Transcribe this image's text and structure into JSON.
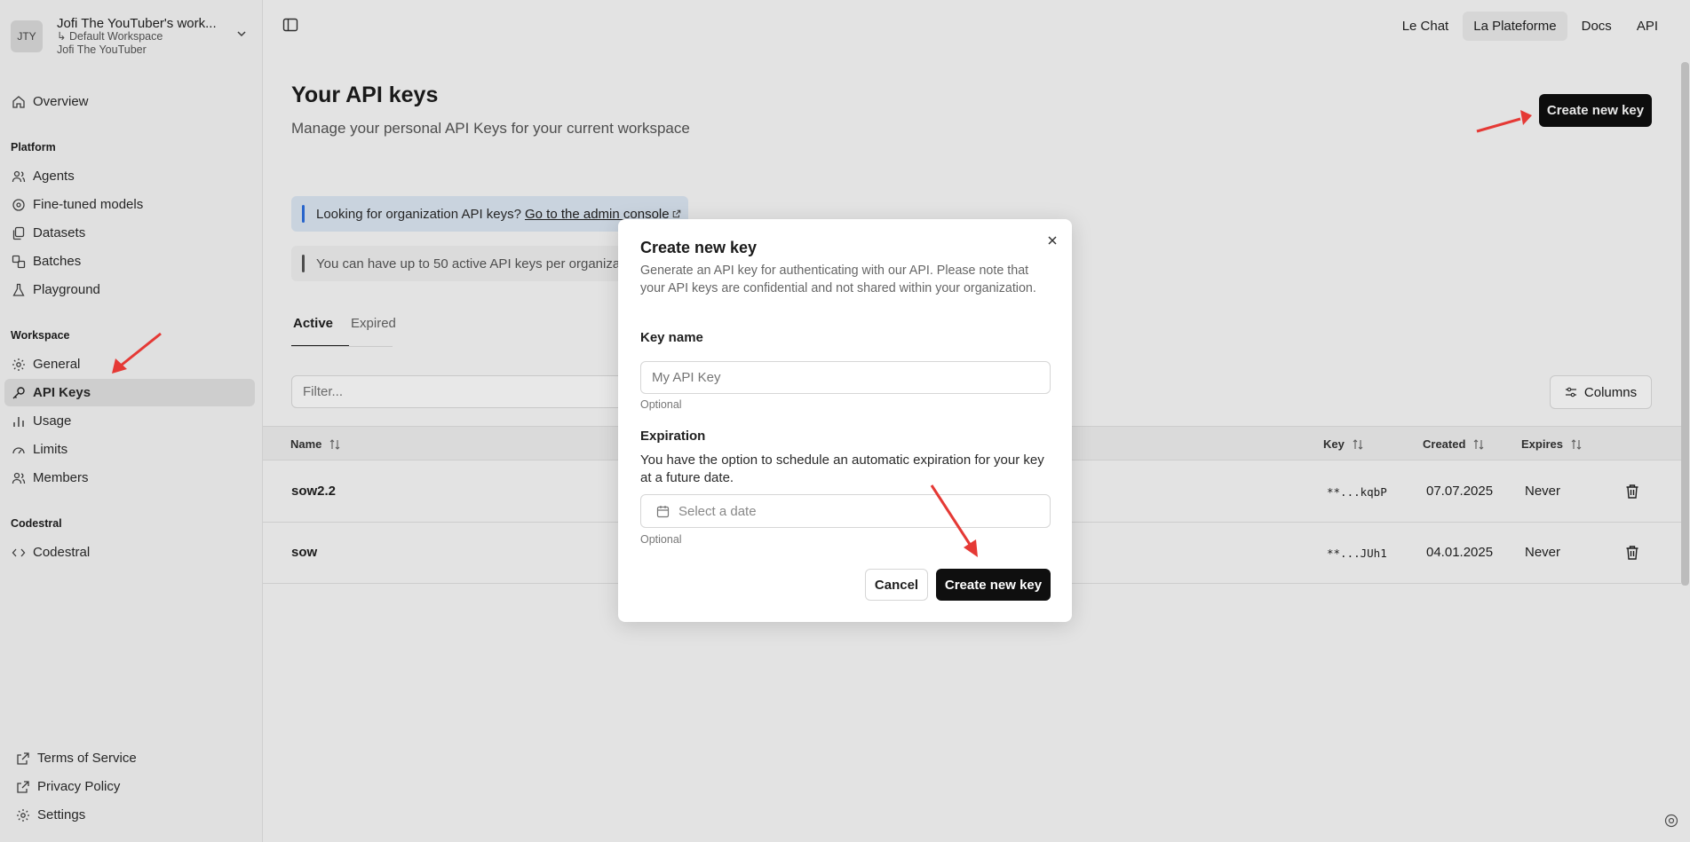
{
  "workspace": {
    "avatar": "JTY",
    "name": "Jofi The YouTuber's work...",
    "sub": "↳ Default Workspace",
    "owner": "Jofi The YouTuber"
  },
  "sidebar": {
    "overview": "Overview",
    "platform_title": "Platform",
    "platform": [
      "Agents",
      "Fine-tuned models",
      "Datasets",
      "Batches",
      "Playground"
    ],
    "workspace_title": "Workspace",
    "workspace": [
      "General",
      "API Keys",
      "Usage",
      "Limits",
      "Members"
    ],
    "codestral_title": "Codestral",
    "codestral": [
      "Codestral"
    ],
    "footer": [
      "Terms of Service",
      "Privacy Policy",
      "Settings"
    ]
  },
  "topnav": [
    "Le Chat",
    "La Plateforme",
    "Docs",
    "API"
  ],
  "main": {
    "title": "Your API keys",
    "subtitle": "Manage your personal API Keys for your current workspace",
    "create_button": "Create new key",
    "info_text": "Looking for organization API keys?",
    "info_link": "Go to the admin console",
    "limit_text": "You can have up to 50 active API keys per organiza",
    "tabs": [
      "Active",
      "Expired"
    ],
    "filter_placeholder": "Filter...",
    "columns_button": "Columns"
  },
  "table": {
    "headers": {
      "name": "Name",
      "key": "Key",
      "created": "Created",
      "expires": "Expires"
    },
    "rows": [
      {
        "name": "sow2.2",
        "key": "**...kqbP",
        "created": "07.07.2025",
        "expires": "Never"
      },
      {
        "name": "sow",
        "key": "**...JUh1",
        "created": "04.01.2025",
        "expires": "Never"
      }
    ]
  },
  "modal": {
    "title": "Create new key",
    "description": "Generate an API key for authenticating with our API. Please note that your API keys are confidential and not shared within your organization.",
    "key_name_label": "Key name",
    "key_name_placeholder": "My API Key",
    "optional": "Optional",
    "expiration_label": "Expiration",
    "expiration_note": "You have the option to schedule an automatic expiration for your key at a future date.",
    "date_placeholder": "Select a date",
    "cancel": "Cancel",
    "create": "Create new key"
  },
  "colors": {
    "accent_dark": "#0f0f0f",
    "info_bg": "#dde8f5",
    "info_bar": "#2e70e0",
    "annotation_arrow": "#e53935"
  }
}
